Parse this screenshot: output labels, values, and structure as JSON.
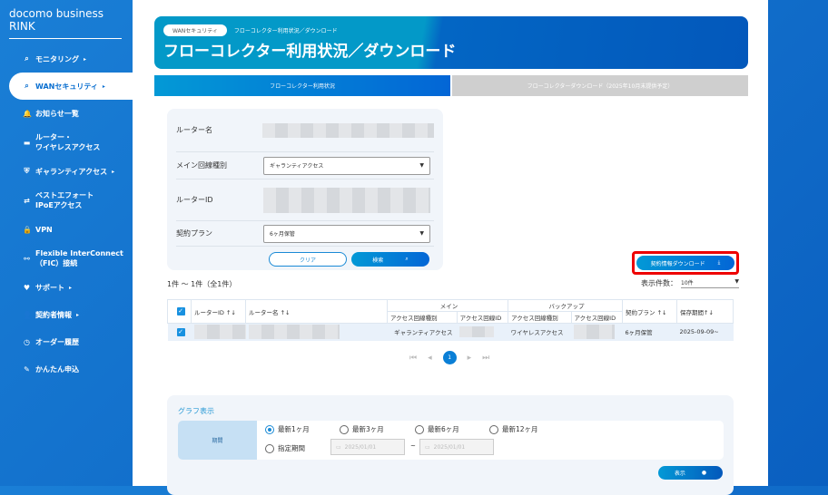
{
  "brand": "docomo business RINK",
  "nav": [
    {
      "label": "モニタリング",
      "arrow": "▸",
      "icon": "⌕"
    },
    {
      "label": "WANセキュリティ",
      "arrow": "▸",
      "icon": "⌕"
    },
    {
      "label": "お知らせ一覧",
      "arrow": "",
      "icon": "🔔"
    },
    {
      "label": "ルーター・\nワイヤレスアクセス",
      "arrow": "",
      "icon": "▬"
    },
    {
      "label": "ギャランティアクセス",
      "arrow": "▸",
      "icon": "⛨"
    },
    {
      "label": "ベストエフォート\nIPoEアクセス",
      "arrow": "",
      "icon": "⇄"
    },
    {
      "label": "VPN",
      "arrow": "",
      "icon": "🔒"
    },
    {
      "label": "Flexible InterConnect\n（FIC）接続",
      "arrow": "",
      "icon": "⚯"
    },
    {
      "label": "サポート",
      "arrow": "▸",
      "icon": "♥"
    },
    {
      "label": "契約者情報",
      "arrow": "▸",
      "icon": "👤"
    },
    {
      "label": "オーダー履歴",
      "arrow": "",
      "icon": "◷"
    },
    {
      "label": "かんたん申込",
      "arrow": "",
      "icon": "✎"
    }
  ],
  "breadcrumb": [
    "WANセキュリティ",
    "フローコレクター利用状況／ダウンロード"
  ],
  "title": "フローコレクター利用状況／ダウンロード",
  "tabs": [
    "フローコレクター利用状況",
    "フローコレクターダウンロード（2025年10月末提供予定）"
  ],
  "form": {
    "router_name": "ルーター名",
    "main_line": "メイン回線種別",
    "main_line_value": "ギャランティアクセス",
    "router_id": "ルーターID",
    "plan": "契約プラン",
    "plan_value": "6ヶ月保管",
    "clear": "クリア",
    "search": "検索"
  },
  "download_label": "契約情報ダウンロード",
  "count": "1件 ～ 1件（全1件）",
  "per_page_label": "表示件数：",
  "per_page_value": "10件",
  "table": {
    "router_id": "ルーターID ↑↓",
    "router_name": "ルーター名 ↑↓",
    "main": "メイン",
    "backup": "バックアップ",
    "access_type": "アクセス回線種別",
    "access_id": "アクセス回線ID",
    "plan": "契約プラン ↑↓",
    "period": "保存期間↑↓",
    "rows": [
      {
        "main_type": "ギャランティアクセス",
        "backup_type": "ワイヤレスアクセス",
        "plan": "6ヶ月保管",
        "period": "2025-09-09~"
      }
    ]
  },
  "page": "1",
  "graph": {
    "title": "グラフ表示",
    "period_label": "期間",
    "options": [
      "最新1ヶ月",
      "最新3ヶ月",
      "最新6ヶ月",
      "最新12ヶ月",
      "指定期間"
    ],
    "selected": 0,
    "date_from": "2025/01/01",
    "date_to": "2025/01/01",
    "sep": "~",
    "show": "表示"
  }
}
